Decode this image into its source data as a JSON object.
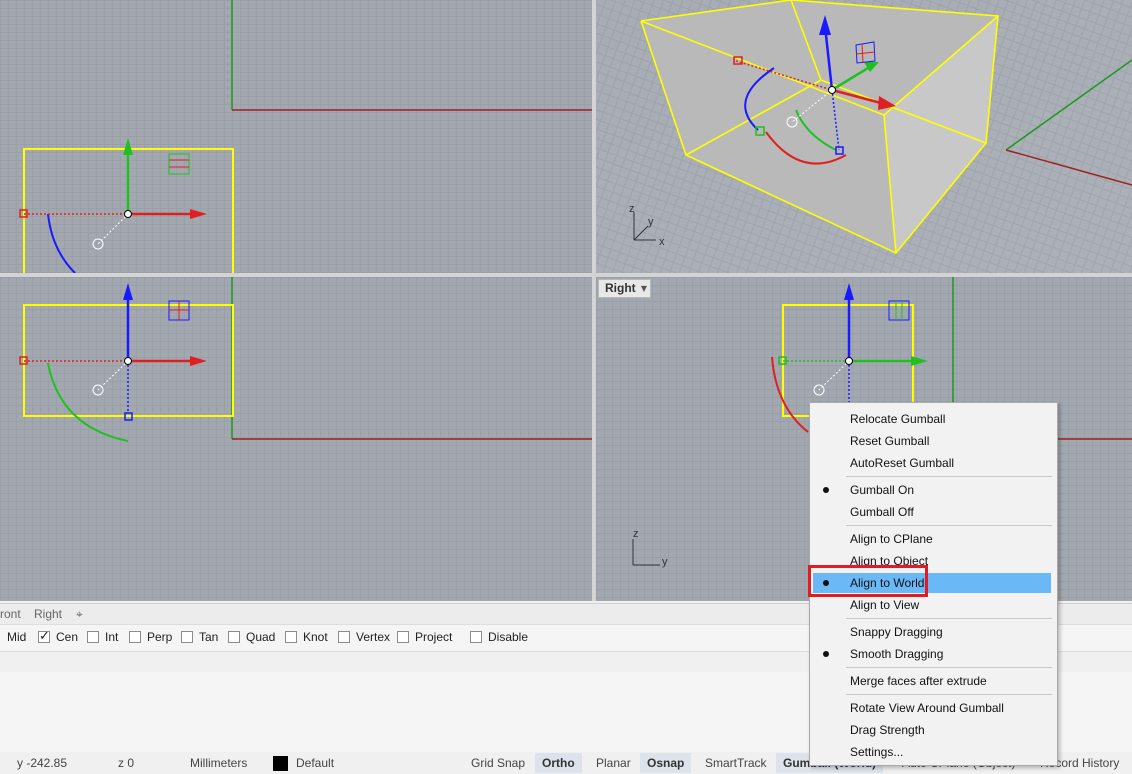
{
  "viewports": {
    "right_label": "Right",
    "persp_axes": {
      "z": "z",
      "y": "y",
      "x": "x"
    },
    "right_axes": {
      "z": "z",
      "y": "y"
    }
  },
  "tabs": [
    "ront",
    "Right"
  ],
  "osnaps": [
    {
      "label": "Mid",
      "checked": false
    },
    {
      "label": "Cen",
      "checked": true
    },
    {
      "label": "Int",
      "checked": false
    },
    {
      "label": "Perp",
      "checked": false
    },
    {
      "label": "Tan",
      "checked": false
    },
    {
      "label": "Quad",
      "checked": false
    },
    {
      "label": "Knot",
      "checked": false
    },
    {
      "label": "Vertex",
      "checked": false
    },
    {
      "label": "Project",
      "checked": false
    },
    {
      "label": "Disable",
      "checked": false
    }
  ],
  "status": {
    "y": "y -242.85",
    "z": "z 0",
    "units": "Millimeters",
    "layer": "Default",
    "grid_snap": "Grid Snap",
    "ortho": "Ortho",
    "planar": "Planar",
    "osnap": "Osnap",
    "smarttrack": "SmartTrack",
    "gumball": "Gumball (World)",
    "autocplane": "Auto CPlane (Object)",
    "record_history": "Record History"
  },
  "context_menu": {
    "items": [
      {
        "label": "Relocate Gumball"
      },
      {
        "label": "Reset Gumball"
      },
      {
        "label": "AutoReset Gumball"
      },
      {
        "label": "Gumball On",
        "bullet": true
      },
      {
        "label": "Gumball Off"
      },
      {
        "label": "Align to CPlane"
      },
      {
        "label": "Align to Object"
      },
      {
        "label": "Align to World",
        "bullet": true,
        "highlighted": true
      },
      {
        "label": "Align to View"
      },
      {
        "label": "Snappy Dragging"
      },
      {
        "label": "Smooth Dragging",
        "bullet": true
      },
      {
        "label": "Merge faces after extrude"
      },
      {
        "label": "Rotate View Around Gumball"
      },
      {
        "label": "Drag Strength"
      },
      {
        "label": "Settings..."
      }
    ]
  },
  "colors": {
    "accent_highlight": "#6bb8f7",
    "annotation_box": "#e31b23",
    "object_outline": "#ffff00",
    "x_axis": "#e02020",
    "y_axis": "#20c020",
    "z_axis": "#2030e0"
  }
}
